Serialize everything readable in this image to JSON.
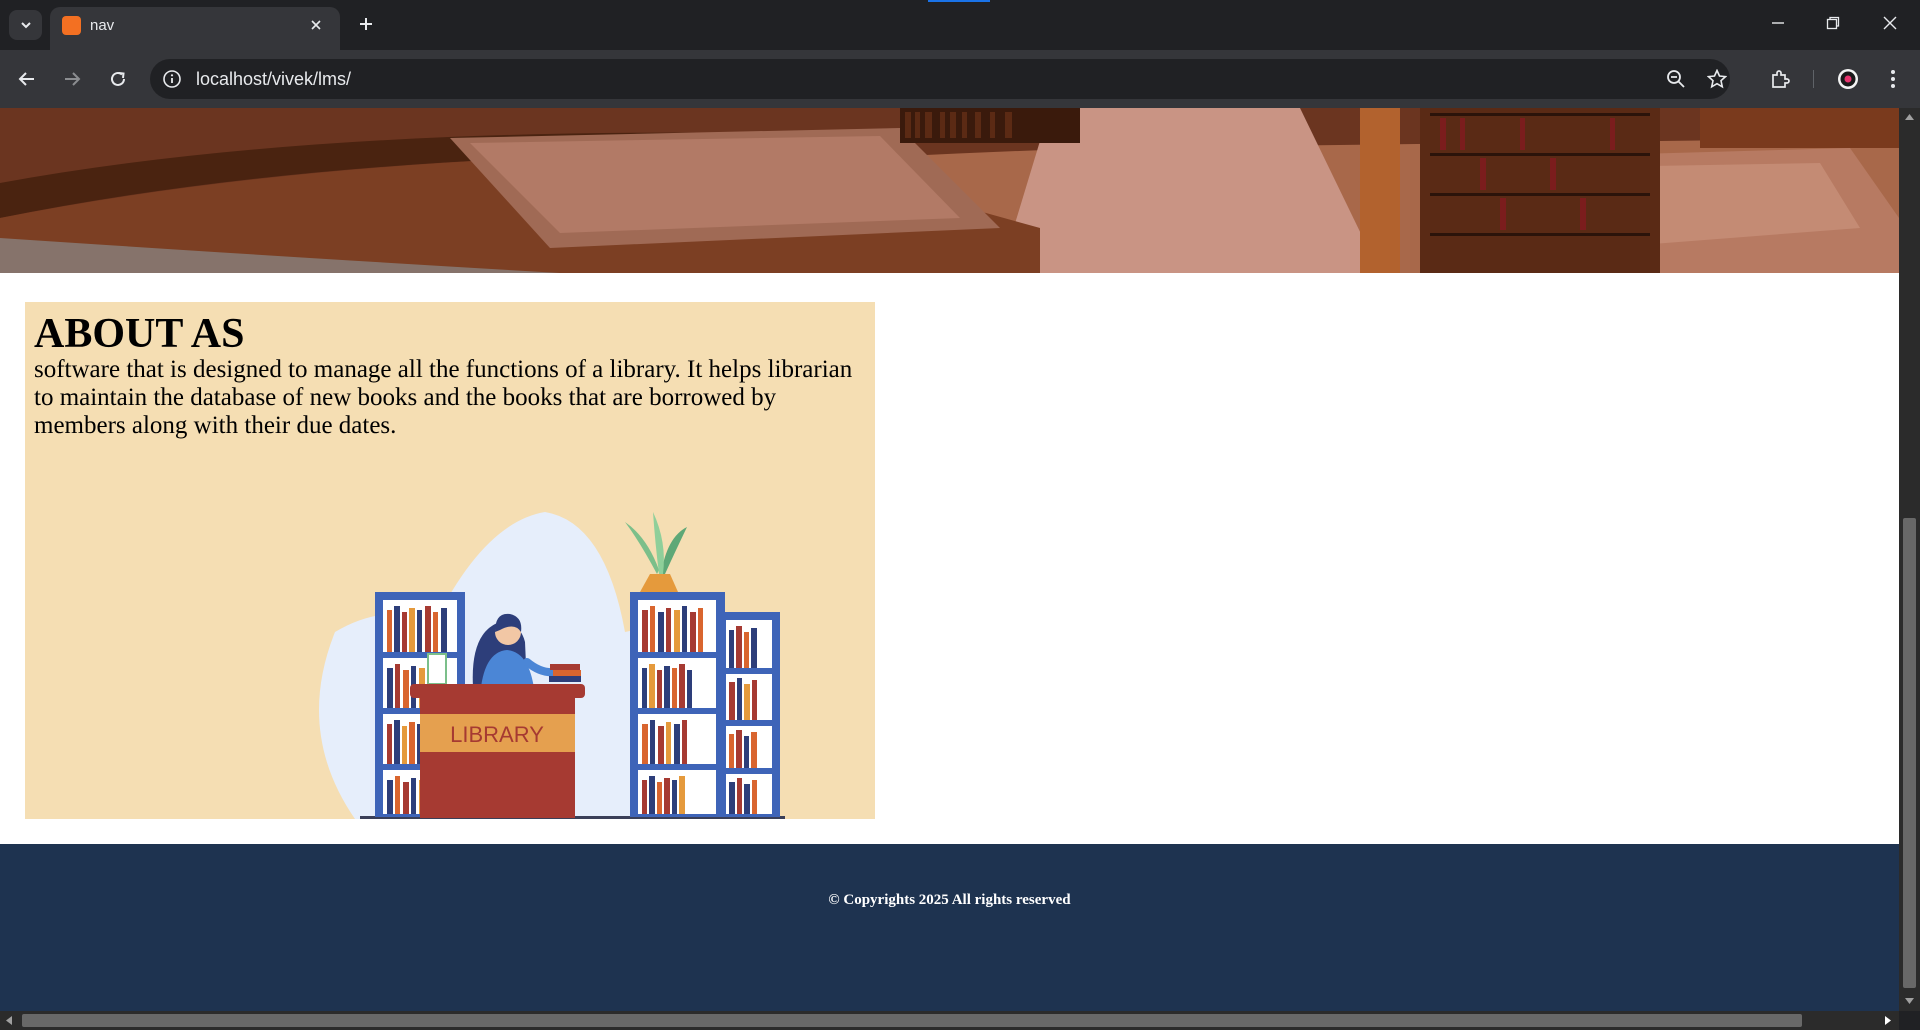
{
  "browser": {
    "tab_title": "nav",
    "url": "localhost/vivek/lms/"
  },
  "page": {
    "about": {
      "title": "ABOUT AS",
      "description": "software that is designed to manage all the functions of a library. It helps librarian to maintain the database of new books and the books that are borrowed by members along with their due dates.",
      "illustration_sign": "LIBRARY"
    },
    "footer": {
      "copyright": "© Copyrights 2025 All rights reserved"
    }
  },
  "colors": {
    "about_bg": "#f5deb3",
    "footer_bg": "#1e3350"
  }
}
